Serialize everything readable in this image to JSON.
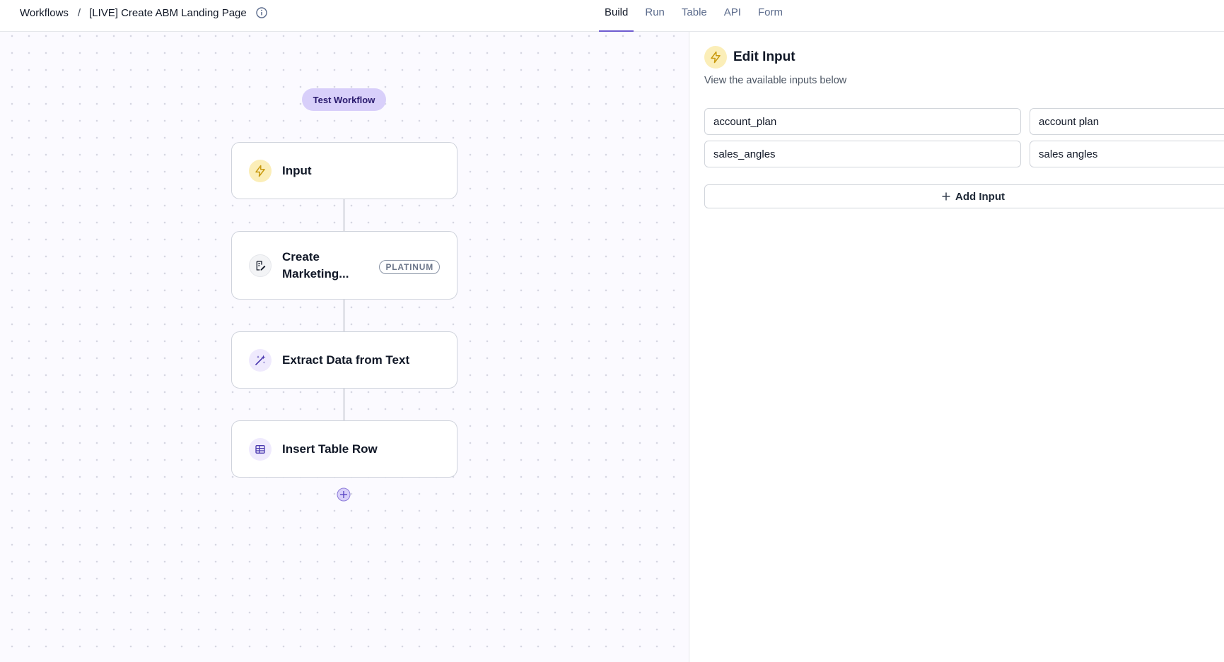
{
  "breadcrumb": {
    "root": "Workflows",
    "separator": "/",
    "current": "[LIVE] Create ABM Landing Page"
  },
  "tabs": [
    {
      "label": "Build",
      "active": true
    },
    {
      "label": "Run",
      "active": false
    },
    {
      "label": "Table",
      "active": false
    },
    {
      "label": "API",
      "active": false
    },
    {
      "label": "Form",
      "active": false
    }
  ],
  "canvas": {
    "test_button": "Test Workflow",
    "nodes": [
      {
        "label": "Input",
        "icon": "lightning-icon"
      },
      {
        "label": "Create Marketing...",
        "icon": "edit-document-icon",
        "badge": "PLATINUM"
      },
      {
        "label": "Extract Data from Text",
        "icon": "magic-wand-icon"
      },
      {
        "label": "Insert Table Row",
        "icon": "table-icon"
      }
    ]
  },
  "panel": {
    "title": "Edit Input",
    "subtitle": "View the available inputs below",
    "inputs": [
      {
        "key": "account_plan",
        "label": "account plan"
      },
      {
        "key": "sales_angles",
        "label": "sales angles"
      }
    ],
    "add_button": "Add Input"
  },
  "colors": {
    "accent": "#6d5bd0",
    "test_button_bg": "#d8cffa",
    "input_icon_bg": "#fbeeb8",
    "canvas_bg": "#fbfaff"
  }
}
